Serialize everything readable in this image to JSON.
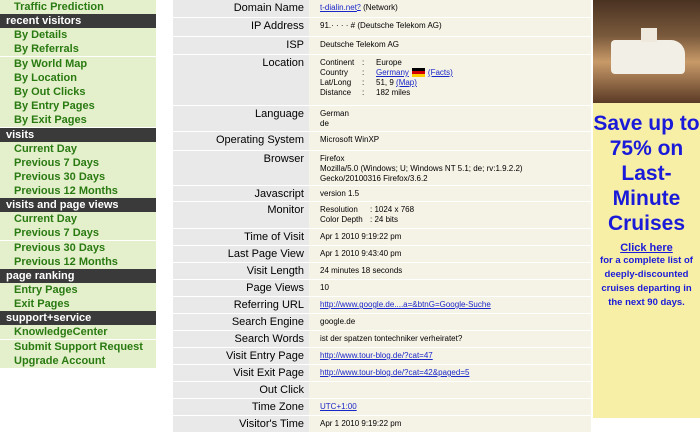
{
  "sidebar": {
    "items": [
      {
        "type": "link",
        "label": "Traffic Prediction",
        "name": "traffic-prediction"
      },
      {
        "type": "head",
        "label": "recent visitors",
        "name": "recent-visitors"
      },
      {
        "type": "link",
        "label": "By Details",
        "name": "by-details"
      },
      {
        "type": "link",
        "label": "By Referrals",
        "name": "by-referrals"
      },
      {
        "type": "link",
        "label": "By World Map",
        "name": "by-world-map"
      },
      {
        "type": "link",
        "label": "By Location",
        "name": "by-location"
      },
      {
        "type": "link",
        "label": "By Out Clicks",
        "name": "by-out-clicks"
      },
      {
        "type": "link",
        "label": "By Entry Pages",
        "name": "by-entry-pages"
      },
      {
        "type": "link",
        "label": "By Exit Pages",
        "name": "by-exit-pages"
      },
      {
        "type": "head",
        "label": "visits",
        "name": "visits"
      },
      {
        "type": "link",
        "label": "Current Day",
        "name": "visits-current-day"
      },
      {
        "type": "link",
        "label": "Previous 7 Days",
        "name": "visits-previous-7-days"
      },
      {
        "type": "link",
        "label": "Previous 30 Days",
        "name": "visits-previous-30-days"
      },
      {
        "type": "link",
        "label": "Previous 12 Months",
        "name": "visits-previous-12-months"
      },
      {
        "type": "head",
        "label": "visits and page views",
        "name": "visits-and-page-views"
      },
      {
        "type": "link",
        "label": "Current Day",
        "name": "views-current-day"
      },
      {
        "type": "link",
        "label": "Previous 7 Days",
        "name": "views-previous-7-days"
      },
      {
        "type": "link",
        "label": "Previous 30 Days",
        "name": "views-previous-30-days"
      },
      {
        "type": "link",
        "label": "Previous 12 Months",
        "name": "views-previous-12-months"
      },
      {
        "type": "head",
        "label": "page ranking",
        "name": "page-ranking"
      },
      {
        "type": "link",
        "label": "Entry Pages",
        "name": "entry-pages"
      },
      {
        "type": "link",
        "label": "Exit Pages",
        "name": "exit-pages"
      },
      {
        "type": "head",
        "label": "support+service",
        "name": "support-service"
      },
      {
        "type": "link",
        "label": "KnowledgeCenter",
        "name": "knowledge-center"
      },
      {
        "type": "link",
        "label": "Submit Support Request",
        "name": "submit-support-request"
      },
      {
        "type": "link",
        "label": "Upgrade Account",
        "name": "upgrade-account"
      }
    ]
  },
  "details": {
    "domain_name": {
      "label": "Domain Name",
      "link": "t-dialin.net",
      "sup": "?",
      "suffix": "(Network)"
    },
    "ip_address": {
      "label": "IP Address",
      "value": "91.· · · · # (Deutsche Telekom AG)"
    },
    "isp": {
      "label": "ISP",
      "value": "Deutsche Telekom AG"
    },
    "location": {
      "label": "Location",
      "continent_key": "Continent",
      "continent_val": "Europe",
      "country_key": "Country",
      "country_link": "Germany",
      "country_facts": "(Facts)",
      "latlong_key": "Lat/Long",
      "latlong_val": "51, 9",
      "latlong_map": "(Map)",
      "distance_key": "Distance",
      "distance_val": "182 miles",
      "sep": ":"
    },
    "language": {
      "label": "Language",
      "line1": "German",
      "line2": "de"
    },
    "os": {
      "label": "Operating System",
      "value": "Microsoft WinXP"
    },
    "browser": {
      "label": "Browser",
      "line1": "Firefox",
      "line2": "Mozilla/5.0 (Windows; U; Windows NT 5.1; de; rv:1.9.2.2)",
      "line3": "Gecko/20100316 Firefox/3.6.2"
    },
    "javascript": {
      "label": "Javascript",
      "value": "version 1.5"
    },
    "monitor": {
      "label": "Monitor",
      "res_key": "Resolution",
      "res_val": ": 1024 x 768",
      "depth_key": "Color Depth",
      "depth_val": ": 24 bits"
    },
    "time_of_visit": {
      "label": "Time of Visit",
      "value": "Apr 1 2010 9:19:22 pm"
    },
    "last_page_view": {
      "label": "Last Page View",
      "value": "Apr 1 2010 9:43:40 pm"
    },
    "visit_length": {
      "label": "Visit Length",
      "value": "24 minutes 18 seconds"
    },
    "page_views": {
      "label": "Page Views",
      "value": "10"
    },
    "referring_url": {
      "label": "Referring URL",
      "value": "http://www.google.de....a=&btnG=Google-Suche"
    },
    "search_engine": {
      "label": "Search Engine",
      "value": "google.de"
    },
    "search_words": {
      "label": "Search Words",
      "value": "ist der spatzen tontechniker verheiratet?"
    },
    "visit_entry_page": {
      "label": "Visit Entry Page",
      "value": "http://www.tour-blog.de/?cat=47"
    },
    "visit_exit_page": {
      "label": "Visit Exit Page",
      "value": "http://www.tour-blog.de/?cat=42&paged=5"
    },
    "out_click": {
      "label": "Out Click",
      "value": ""
    },
    "time_zone": {
      "label": "Time Zone",
      "value": "UTC+1:00"
    },
    "visitors_time": {
      "label": "Visitor's Time",
      "value": "Apr 1 2010 9:19:22 pm"
    }
  },
  "ad": {
    "headline": "Save up to 75% on Last-Minute Cruises",
    "click": "Click here",
    "text": "for a complete list of deeply-discounted cruises departing in the next 90 days."
  },
  "colors": {
    "sidebar_link": "#2a7a12",
    "sidebar_bg": "#e4f0cc",
    "sidebar_head": "#3a3a3a",
    "ad_bg": "#f8efa6",
    "ad_text": "#1a1ad9"
  }
}
